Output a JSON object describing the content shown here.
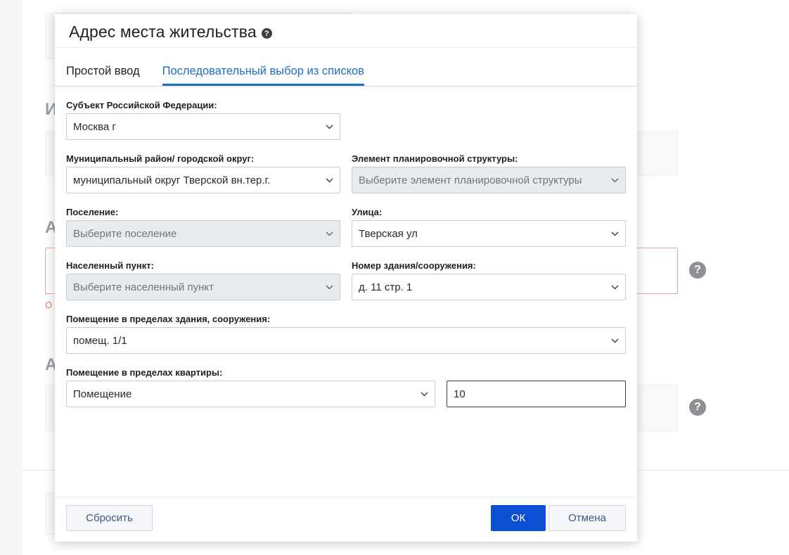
{
  "modal": {
    "title": "Адрес места жительства",
    "help_glyph": "?",
    "tabs": [
      {
        "label": "Простой ввод",
        "active": false
      },
      {
        "label": "Последовательный выбор из списков",
        "active": true
      }
    ],
    "fields": {
      "subject": {
        "label": "Субъект Российской Федерации:",
        "value": "Москва г"
      },
      "district": {
        "label": "Муниципальный район/ городской округ:",
        "value": "муниципальный округ Тверской вн.тер.г."
      },
      "planning_element": {
        "label": "Элемент планировочной структуры:",
        "placeholder": "Выберите элемент планировочной структуры"
      },
      "settlement": {
        "label": "Поселение:",
        "placeholder": "Выберите поселение"
      },
      "street": {
        "label": "Улица:",
        "value": "Тверская ул"
      },
      "locality": {
        "label": "Населенный пункт:",
        "placeholder": "Выберите населенный пункт"
      },
      "building": {
        "label": "Номер здания/сооружения:",
        "value": "д. 11 стр. 1"
      },
      "premises_building": {
        "label": "Помещение в пределах здания, сооружения:",
        "value": "помещ. 1/1"
      },
      "premises_apartment": {
        "label": "Помещение в пределах квартиры:",
        "type_value": "Помещение",
        "number_value": "10"
      }
    },
    "buttons": {
      "reset": "Сбросить",
      "ok": "ОК",
      "cancel": "Отмена"
    }
  },
  "background": {
    "letter_1": "И",
    "letter_2": "А",
    "letter_3": "А",
    "error_char": "О",
    "help_glyph": "?"
  },
  "colors": {
    "accent": "#1e6dc2",
    "primary_button": "#0b4fd3",
    "disabled_field": "#e9ecef",
    "error_border": "#e9a3a3"
  },
  "icons": {
    "dropdown": "chevron-down-icon",
    "help": "question-circle-icon"
  }
}
